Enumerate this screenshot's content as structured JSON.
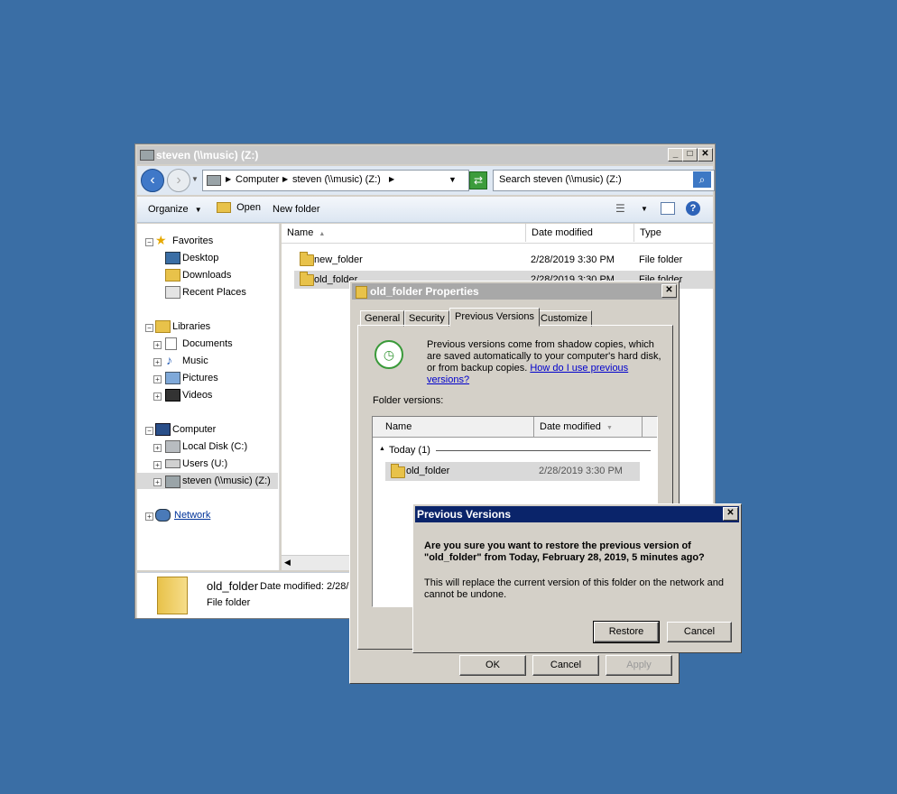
{
  "explorer": {
    "title": "steven (\\\\music) (Z:)",
    "address": {
      "crumbs": [
        "Computer",
        "steven (\\\\music) (Z:)"
      ]
    },
    "search_placeholder": "Search steven (\\\\music) (Z:)",
    "toolbar": {
      "organize": "Organize",
      "open": "Open",
      "new_folder": "New folder"
    },
    "nav": {
      "favorites": "Favorites",
      "desktop": "Desktop",
      "downloads": "Downloads",
      "recent_places": "Recent Places",
      "libraries": "Libraries",
      "documents": "Documents",
      "music": "Music",
      "pictures": "Pictures",
      "videos": "Videos",
      "computer": "Computer",
      "local_disk": "Local Disk (C:)",
      "users": "Users (U:)",
      "steven": "steven (\\\\music) (Z:)",
      "network": "Network"
    },
    "columns": {
      "name": "Name",
      "date": "Date modified",
      "type": "Type"
    },
    "files": [
      {
        "name": "new_folder",
        "date": "2/28/2019 3:30 PM",
        "type": "File folder"
      },
      {
        "name": "old_folder",
        "date": "2/28/2019 3:30 PM",
        "type": "File folder"
      }
    ],
    "details": {
      "name": "old_folder",
      "date_label": "Date modified:",
      "date_value": "2/28/",
      "type": "File folder"
    }
  },
  "properties": {
    "title": "old_folder Properties",
    "tabs": [
      "General",
      "Security",
      "Previous Versions",
      "Customize"
    ],
    "info_text": "Previous versions come from shadow copies, which are saved automatically to your computer's hard disk, or from backup copies.",
    "help_link": "How do I use previous versions?",
    "folder_versions_label": "Folder versions:",
    "columns": {
      "name": "Name",
      "date": "Date modified"
    },
    "group": "Today (1)",
    "versions": [
      {
        "name": "old_folder",
        "date": "2/28/2019 3:30 PM"
      }
    ],
    "buttons": {
      "ok": "OK",
      "cancel": "Cancel",
      "apply": "Apply"
    }
  },
  "confirm": {
    "title": "Previous Versions",
    "question": "Are you sure you want to restore the previous version of \"old_folder\" from Today, February 28, 2019, 5 minutes ago?",
    "detail": "This will replace the current version of this folder on the network and cannot be undone.",
    "restore": "Restore",
    "cancel": "Cancel"
  }
}
